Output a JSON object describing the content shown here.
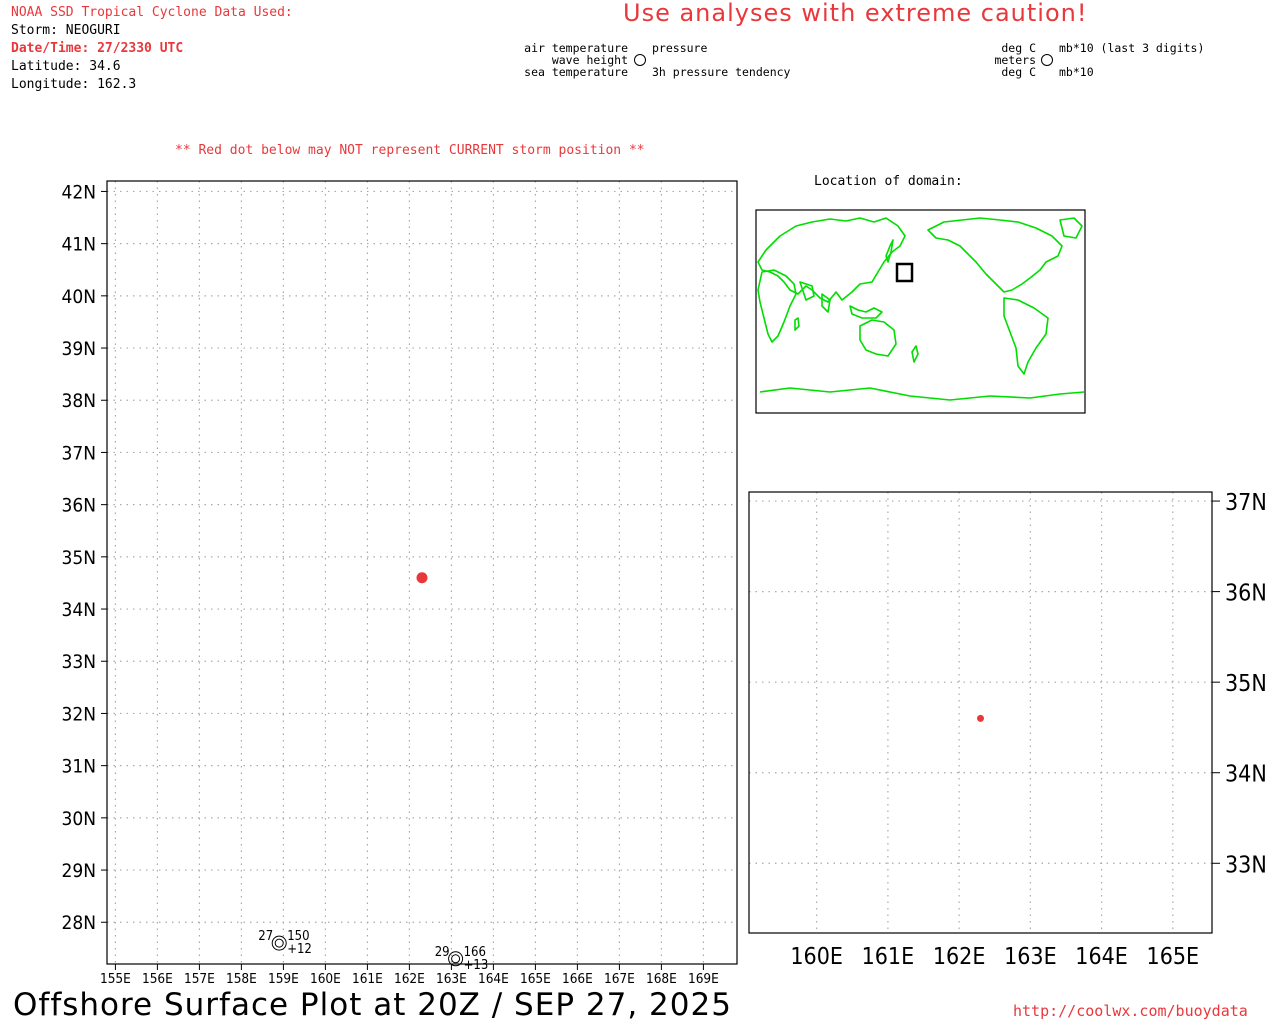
{
  "header": {
    "source_line": "NOAA SSD Tropical Cyclone Data Used:",
    "storm": "Storm: NEOGURI",
    "datetime": "Date/Time: 27/2330 UTC",
    "latitude": "Latitude: 34.6",
    "longitude": "Longitude: 162.3",
    "caution": "Use analyses with extreme caution!",
    "red_dot_warning": "** Red dot below may NOT represent CURRENT storm position **"
  },
  "legend": {
    "left": {
      "air_temperature": "air temperature",
      "wave_height": "wave height",
      "sea_temperature": "sea temperature",
      "pressure": "pressure",
      "pressure_tendency": "3h pressure tendency"
    },
    "right": {
      "deg_c_top": "deg C",
      "meters": "meters",
      "deg_c_bottom": "deg C",
      "mb_last3": "mb*10 (last 3 digits)",
      "mb": "mb*10"
    }
  },
  "inset": {
    "title": "Location of domain:",
    "domain_box": {
      "lon_min": 155,
      "lon_max": 169.5,
      "lat_min": 27,
      "lat_max": 42
    }
  },
  "footer": {
    "title": "Offshore Surface Plot at 20Z / SEP 27, 2025",
    "url": "http://coolwx.com/buoydata"
  },
  "colors": {
    "accent_red": "#e8383c",
    "coastline_green": "#00dd00",
    "grid": "#aaaaaa"
  },
  "chart_data": [
    {
      "type": "scatter",
      "name": "main-map",
      "xlim": [
        154.8,
        169.8
      ],
      "ylim": [
        27.2,
        42.2
      ],
      "x_ticks": [
        "155E",
        "156E",
        "157E",
        "158E",
        "159E",
        "160E",
        "161E",
        "162E",
        "163E",
        "164E",
        "165E",
        "166E",
        "167E",
        "168E",
        "169E"
      ],
      "y_ticks": [
        "42N",
        "41N",
        "40N",
        "39N",
        "38N",
        "37N",
        "36N",
        "35N",
        "34N",
        "33N",
        "32N",
        "31N",
        "30N",
        "29N",
        "28N"
      ],
      "storm": {
        "lon": 162.3,
        "lat": 34.6
      },
      "stations": [
        {
          "lon": 158.9,
          "lat": 27.6,
          "air_temp": "27",
          "pressure": "150",
          "tendency": "+12"
        },
        {
          "lon": 163.1,
          "lat": 27.3,
          "air_temp": "29",
          "pressure": "166",
          "tendency": "+13"
        }
      ]
    },
    {
      "type": "scatter",
      "name": "zoom-map",
      "xlim": [
        159.05,
        165.55
      ],
      "ylim": [
        32.23,
        37.1
      ],
      "x_ticks": [
        "160E",
        "161E",
        "162E",
        "163E",
        "164E",
        "165E"
      ],
      "y_ticks": [
        "37N",
        "36N",
        "35N",
        "34N",
        "33N"
      ],
      "storm": {
        "lon": 162.3,
        "lat": 34.6
      }
    }
  ]
}
